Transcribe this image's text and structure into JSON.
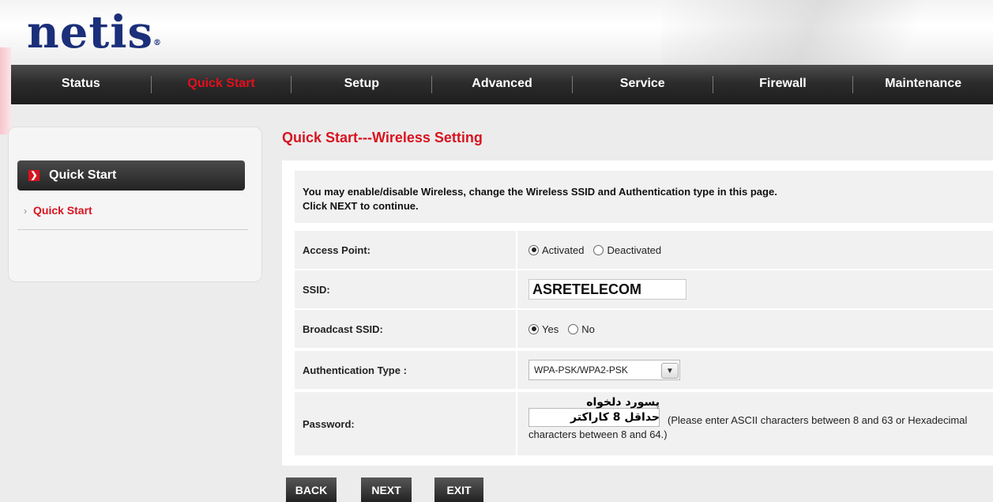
{
  "brand": {
    "logo_text": "netis",
    "trademark": "®"
  },
  "nav": {
    "items": [
      {
        "label": "Status",
        "active": false
      },
      {
        "label": "Quick Start",
        "active": true
      },
      {
        "label": "Setup",
        "active": false
      },
      {
        "label": "Advanced",
        "active": false
      },
      {
        "label": "Service",
        "active": false
      },
      {
        "label": "Firewall",
        "active": false
      },
      {
        "label": "Maintenance",
        "active": false
      }
    ]
  },
  "sidebar": {
    "heading": "Quick Start",
    "heading_icon": "arrow-right-icon",
    "link_icon": "chevron-right-icon",
    "items": [
      {
        "label": "Quick Start"
      }
    ]
  },
  "main": {
    "title": "Quick Start---Wireless Setting",
    "intro_line1": "You may enable/disable Wireless, change the Wireless SSID and Authentication type in this page.",
    "intro_line2": "Click NEXT to continue.",
    "access_point": {
      "label": "Access Point:",
      "options": [
        "Activated",
        "Deactivated"
      ],
      "selected": "Activated"
    },
    "ssid": {
      "label": "SSID:",
      "value": "ASRETELECOM"
    },
    "broadcast": {
      "label": "Broadcast SSID:",
      "options": [
        "Yes",
        "No"
      ],
      "selected": "Yes"
    },
    "auth": {
      "label": "Authentication Type :",
      "value": "WPA-PSK/WPA2-PSK"
    },
    "password": {
      "label": "Password:",
      "overlay_line1": "پسورد دلخواه",
      "overlay_line2": "حداقل 8 کاراکتر",
      "note": "(Please enter ASCII characters between 8 and 63 or Hexadecimal characters between 8 and 64.)"
    }
  },
  "buttons": {
    "back": "BACK",
    "next": "NEXT",
    "exit": "EXIT"
  },
  "colors": {
    "accent": "#d8131f",
    "nav_bg": "#2c2c2c",
    "logo": "#1b2f7a"
  }
}
